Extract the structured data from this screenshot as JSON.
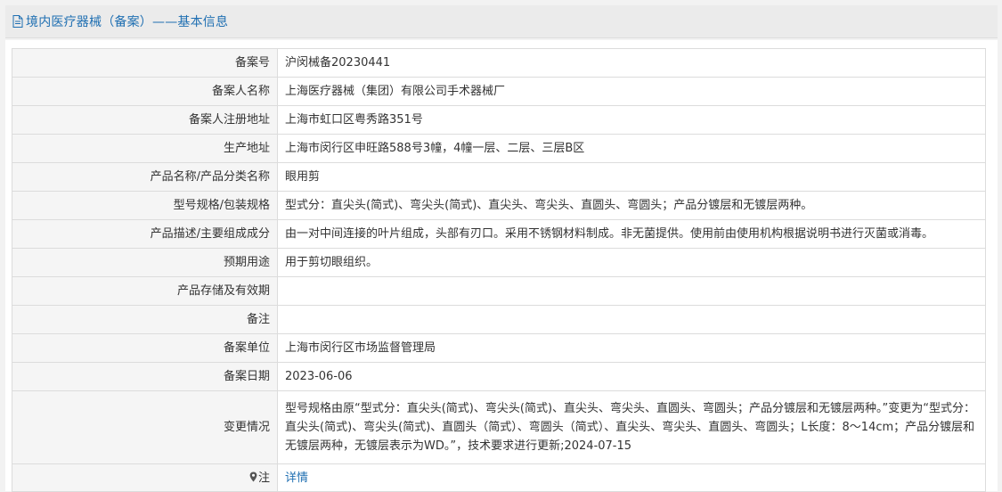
{
  "header": {
    "title": "境内医疗器械（备案）——基本信息"
  },
  "rows": [
    {
      "label": "备案号",
      "value": "沪闵械备20230441"
    },
    {
      "label": "备案人名称",
      "value": "上海医疗器械（集团）有限公司手术器械厂"
    },
    {
      "label": "备案人注册地址",
      "value": "上海市虹口区粤秀路351号"
    },
    {
      "label": "生产地址",
      "value": "上海市闵行区申旺路588号3幢，4幢一层、二层、三层B区"
    },
    {
      "label": "产品名称/产品分类名称",
      "value": "眼用剪"
    },
    {
      "label": "型号规格/包装规格",
      "value": "型式分：直尖头(简式)、弯尖头(简式)、直尖头、弯尖头、直圆头、弯圆头；产品分镀层和无镀层两种。"
    },
    {
      "label": "产品描述/主要组成成分",
      "value": "由一对中间连接的叶片组成，头部有刃口。采用不锈钢材料制成。非无菌提供。使用前由使用机构根据说明书进行灭菌或消毒。"
    },
    {
      "label": "预期用途",
      "value": "用于剪切眼组织。"
    },
    {
      "label": "产品存储及有效期",
      "value": ""
    },
    {
      "label": "备注",
      "value": ""
    },
    {
      "label": "备案单位",
      "value": "上海市闵行区市场监督管理局"
    },
    {
      "label": "备案日期",
      "value": "2023-06-06"
    },
    {
      "label": "变更情况",
      "value": "型号规格由原“型式分：直尖头(简式)、弯尖头(简式)、直尖头、弯尖头、直圆头、弯圆头；产品分镀层和无镀层两种。”变更为“型式分：直尖头(简式)、弯尖头(简式)、直圆头（简式）、弯圆头（简式）、直尖头、弯尖头、直圆头、弯圆头；L长度：8～14cm；产品分镀层和无镀层两种，无镀层表示为WD。”，技术要求进行更新;2024-07-15"
    }
  ],
  "note_row": {
    "label": "注",
    "link": "详情"
  },
  "colors": {
    "accent": "#1f6fb2",
    "label_bg": "#f5f5f5",
    "border": "#dcdcdc"
  }
}
